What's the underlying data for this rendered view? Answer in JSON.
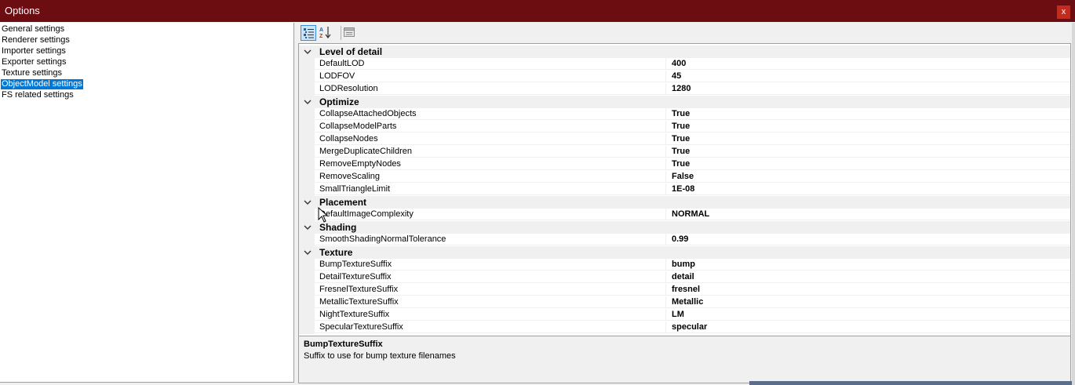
{
  "window": {
    "title": "Options",
    "close_label": "x"
  },
  "categories": [
    {
      "label": "General settings",
      "selected": false
    },
    {
      "label": "Renderer settings",
      "selected": false
    },
    {
      "label": "Importer settings",
      "selected": false
    },
    {
      "label": "Exporter settings",
      "selected": false
    },
    {
      "label": "Texture settings",
      "selected": false
    },
    {
      "label": "ObjectModel settings",
      "selected": true
    },
    {
      "label": "FS related settings",
      "selected": false
    }
  ],
  "toolbar": {
    "buttons": [
      {
        "icon": "categorized-icon",
        "active": true
      },
      {
        "icon": "alphabetical-sort-icon",
        "active": false
      },
      {
        "icon": "property-pages-icon",
        "active": false
      }
    ]
  },
  "property_grid": {
    "groups": [
      {
        "name": "Level of detail",
        "properties": [
          {
            "name": "DefaultLOD",
            "value": "400"
          },
          {
            "name": "LODFOV",
            "value": "45"
          },
          {
            "name": "LODResolution",
            "value": "1280"
          }
        ]
      },
      {
        "name": "Optimize",
        "properties": [
          {
            "name": "CollapseAttachedObjects",
            "value": "True"
          },
          {
            "name": "CollapseModelParts",
            "value": "True"
          },
          {
            "name": "CollapseNodes",
            "value": "True"
          },
          {
            "name": "MergeDuplicateChildren",
            "value": "True"
          },
          {
            "name": "RemoveEmptyNodes",
            "value": "True"
          },
          {
            "name": "RemoveScaling",
            "value": "False"
          },
          {
            "name": "SmallTriangleLimit",
            "value": "1E-08"
          }
        ]
      },
      {
        "name": "Placement",
        "properties": [
          {
            "name": "DefaultImageComplexity",
            "value": "NORMAL"
          }
        ]
      },
      {
        "name": "Shading",
        "properties": [
          {
            "name": "SmoothShadingNormalTolerance",
            "value": "0.99"
          }
        ]
      },
      {
        "name": "Texture",
        "properties": [
          {
            "name": "BumpTextureSuffix",
            "value": "bump"
          },
          {
            "name": "DetailTextureSuffix",
            "value": "detail"
          },
          {
            "name": "FresnelTextureSuffix",
            "value": "fresnel"
          },
          {
            "name": "MetallicTextureSuffix",
            "value": "Metallic"
          },
          {
            "name": "NightTextureSuffix",
            "value": "LM"
          },
          {
            "name": "SpecularTextureSuffix",
            "value": "specular"
          }
        ]
      }
    ]
  },
  "help": {
    "title": "BumpTextureSuffix",
    "description": "Suffix to use for bump texture filenames"
  },
  "colors": {
    "titlebar": "#6b0d11",
    "selection": "#0078d7",
    "close_button": "#c42b1c"
  }
}
